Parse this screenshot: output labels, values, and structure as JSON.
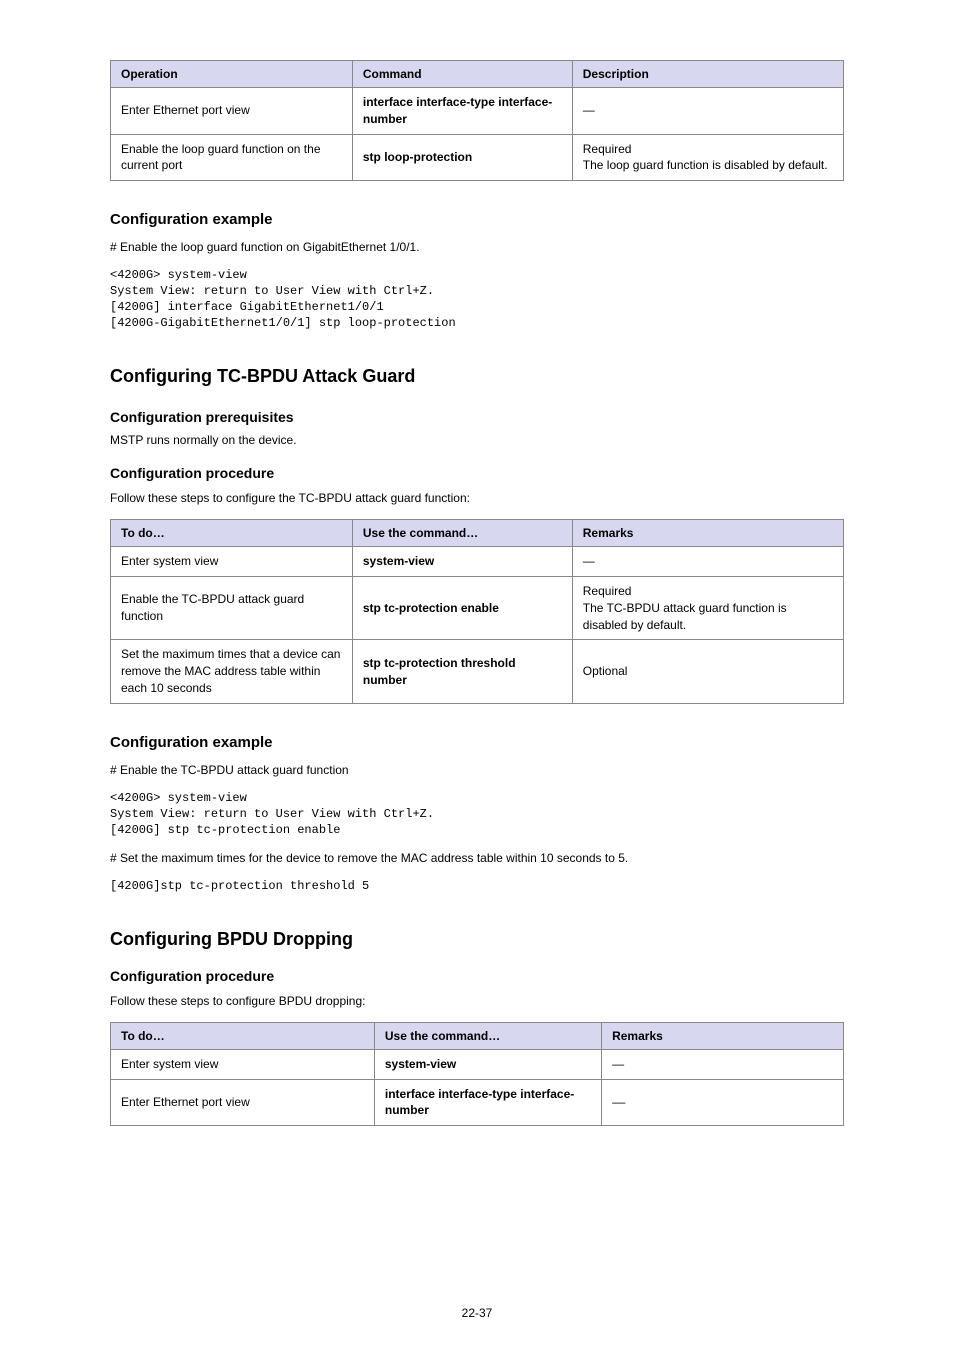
{
  "table1": {
    "headers": [
      "Operation",
      "Command",
      "Description"
    ],
    "rows": [
      {
        "op": "Enter Ethernet port view",
        "cmd": "interface interface-type interface-number",
        "desc": "—"
      },
      {
        "op": "Enable the loop guard function on the current port",
        "cmd": "stp loop-protection",
        "desc": "Required\nThe loop guard function is disabled by default."
      }
    ]
  },
  "section1": {
    "example_heading": "Configuration example",
    "line1": "# Enable the loop guard function on GigabitEthernet 1/0/1.",
    "code1": "<4200G> system-view",
    "code2": "System View: return to User View with Ctrl+Z.",
    "code3": "[4200G] interface GigabitEthernet1/0/1",
    "code4": "[4200G-GigabitEthernet1/0/1] stp loop-protection"
  },
  "tcbpdu": {
    "title": "Configuring TC-BPDU Attack Guard",
    "prereq_heading": "Configuration prerequisites",
    "prereq_text": "MSTP runs normally on the device.",
    "proc_heading": "Configuration procedure",
    "intro": "Follow these steps to configure the TC-BPDU attack guard function:"
  },
  "table2": {
    "headers": [
      "To do…",
      "Use the command…",
      "Remarks"
    ],
    "rows": [
      {
        "op": "Enter system view",
        "cmd": "system-view",
        "desc": "—"
      },
      {
        "op": "Enable the TC-BPDU attack guard function",
        "cmd": "stp tc-protection enable",
        "desc": "Required\nThe TC-BPDU attack guard function is disabled by default."
      },
      {
        "op": "Set the maximum times that a device can remove the MAC address table within each 10 seconds",
        "cmd": "stp tc-protection threshold number",
        "desc": "Optional"
      }
    ]
  },
  "section2": {
    "example_heading": "Configuration example",
    "line1": "# Enable the TC-BPDU attack guard function",
    "code1": "<4200G> system-view",
    "code2": "System View: return to User View with Ctrl+Z.",
    "code3": "[4200G] stp tc-protection enable",
    "line2": "# Set the maximum times for the device to remove the MAC address table within 10 seconds to 5.",
    "code4": "[4200G]stp tc-protection threshold 5"
  },
  "bpdudrop": {
    "title": "Configuring BPDU Dropping",
    "proc_heading": "Configuration procedure",
    "intro": "Follow these steps to configure BPDU dropping:"
  },
  "table3": {
    "headers": [
      "To do…",
      "Use the command…",
      "Remarks"
    ],
    "rows": [
      {
        "op": "Enter system view",
        "cmd": "system-view",
        "desc": "—"
      },
      {
        "op": "Enter Ethernet port view",
        "cmd": "interface interface-type interface-number",
        "desc": "––"
      }
    ]
  },
  "page_number": "22-37"
}
